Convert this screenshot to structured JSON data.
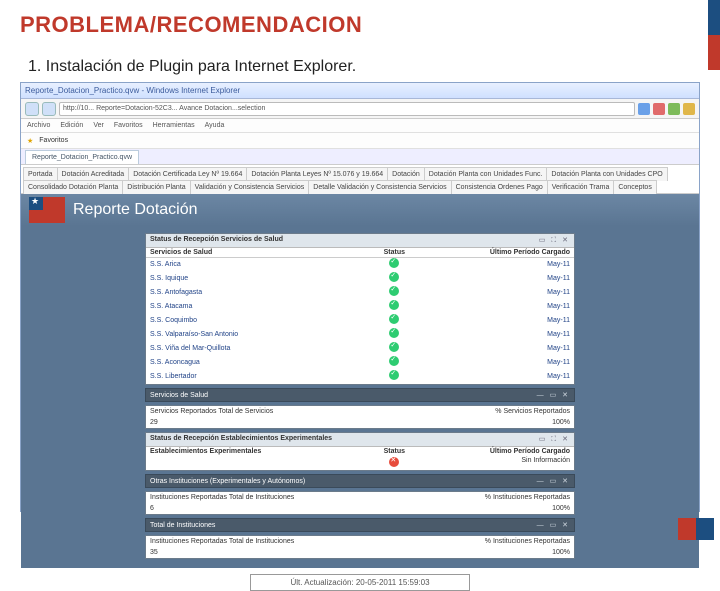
{
  "slide": {
    "heading": "PROBLEMA/RECOMENDACION",
    "subtitle": "1.   Instalación de Plugin para Internet Explorer."
  },
  "browser": {
    "title": "Reporte_Dotacion_Practico.qvw - Windows Internet Explorer",
    "address": "http://10...    Reporte=Dotacion-52C3...    Avance  Dotacion...selection",
    "menus": [
      "Archivo",
      "Edición",
      "Ver",
      "Favoritos",
      "Herramientas",
      "Ayuda"
    ],
    "fav_label": "Favoritos",
    "tab_label": "Reporte_Dotacion_Practico.qvw"
  },
  "app_tabs": [
    "Portada",
    "Dotación Acreditada",
    "Dotación Certificada Ley Nº 19.664",
    "Dotación Planta Leyes Nº 15.076 y 19.664",
    "Dotación",
    "Dotación Planta con Unidades Func.",
    "Dotación Planta con Unidades CPO",
    "Consolidado Dotación Planta",
    "Distribución Planta",
    "Validación y Consistencia Servicios",
    "Detalle Validación y Consistencia Servicios",
    "Consistencia Ordenes Pago",
    "Verificación Trama",
    "Conceptos"
  ],
  "report": {
    "title": "Reporte Dotación"
  },
  "p1": {
    "head": "Status de Recepción Servicios de Salud",
    "col1": "Servicios de Salud",
    "col2": "Status",
    "col3": "Último Período Cargado",
    "rows": [
      {
        "n": "S.S. Arica",
        "p": "May-11"
      },
      {
        "n": "S.S. Iquique",
        "p": "May-11"
      },
      {
        "n": "S.S. Antofagasta",
        "p": "May-11"
      },
      {
        "n": "S.S. Atacama",
        "p": "May-11"
      },
      {
        "n": "S.S. Coquimbo",
        "p": "May-11"
      },
      {
        "n": "S.S. Valparaíso-San Antonio",
        "p": "May-11"
      },
      {
        "n": "S.S. Viña del Mar-Quillota",
        "p": "May-11"
      },
      {
        "n": "S.S. Aconcagua",
        "p": "May-11"
      },
      {
        "n": "S.S. Libertador",
        "p": "May-11"
      }
    ]
  },
  "p2": {
    "head": "Servicios de Salud",
    "label_total": "Servicios Reportados Total de Servicios",
    "val_total": "29",
    "label_pct": "% Servicios Reportados",
    "val_pct": "100%"
  },
  "p3": {
    "head": "Status de Recepción Establecimientos Experimentales",
    "c1": "Establecimientos Experimentales",
    "c2": "Status",
    "c3": "Último Período Cargado",
    "v3": "Sin Información"
  },
  "p4": {
    "head": "Otras Instituciones (Experimentales y Autónomos)",
    "label_total": "Instituciones Reportadas Total de Instituciones",
    "val_mid": "6",
    "label_pct": "% Instituciones Reportadas",
    "val_pct": "100%"
  },
  "p5": {
    "head": "Total de Instituciones",
    "label_total": "Instituciones Reportadas Total de Instituciones",
    "val_mid": "35",
    "label_pct": "% Instituciones Reportadas",
    "val_pct": "100%"
  },
  "updated": "Últ. Actualización: 20-05-2011 15:59:03"
}
